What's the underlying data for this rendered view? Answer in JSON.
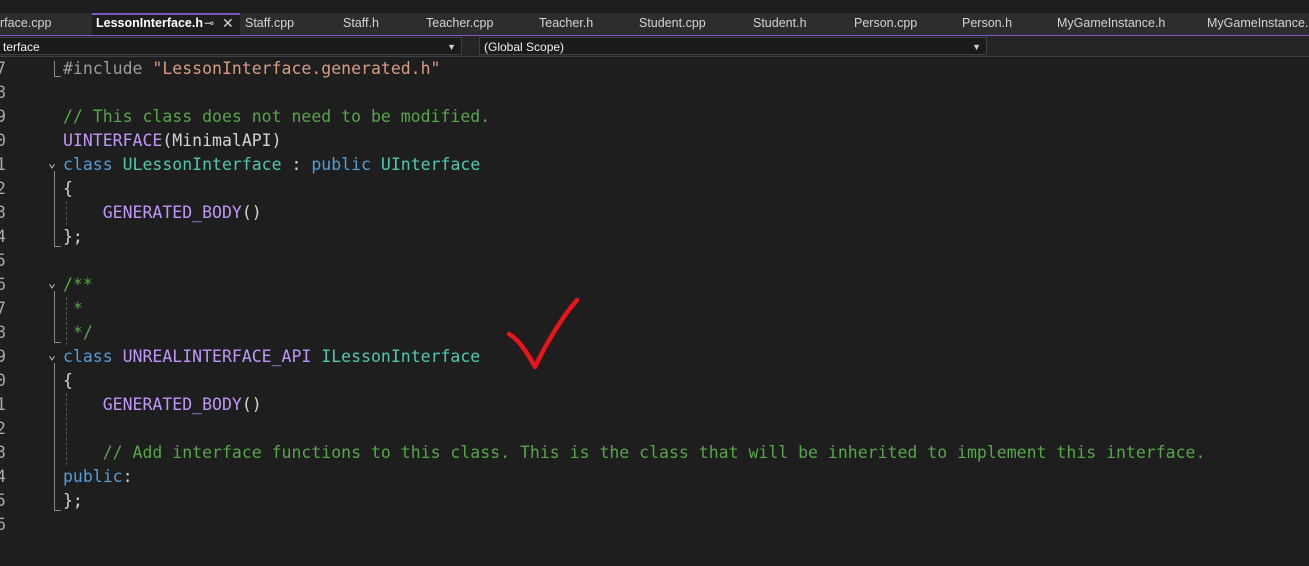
{
  "tabs": [
    {
      "label": "rface.cpp",
      "active": false
    },
    {
      "label": "LessonInterface.h",
      "active": true
    },
    {
      "label": "Staff.cpp",
      "active": false
    },
    {
      "label": "Staff.h",
      "active": false
    },
    {
      "label": "Teacher.cpp",
      "active": false
    },
    {
      "label": "Teacher.h",
      "active": false
    },
    {
      "label": "Student.cpp",
      "active": false
    },
    {
      "label": "Student.h",
      "active": false
    },
    {
      "label": "Person.cpp",
      "active": false
    },
    {
      "label": "Person.h",
      "active": false
    },
    {
      "label": "MyGameInstance.h",
      "active": false
    },
    {
      "label": "MyGameInstance.c",
      "active": false
    }
  ],
  "scope": {
    "left_value": "terface",
    "right_value": "(Global Scope)"
  },
  "icons": {
    "pin": "pin-icon",
    "close": "close-icon",
    "dropdown": "chevron-down-icon",
    "fold": "fold-chevron-icon",
    "annotation": "red-checkmark-annotation"
  },
  "colors": {
    "accent": "#7e57c2",
    "keyword": "#569cd6",
    "class_name": "#4ec9b0",
    "macro": "#bd98f8",
    "string": "#d69d85",
    "comment": "#57a64a",
    "checkmark": "#e8141c"
  },
  "editor": {
    "lines": [
      {
        "num": "7",
        "tokens": [
          [
            "pp",
            "#include "
          ],
          [
            "str",
            "\"LessonInterface.generated.h\""
          ]
        ]
      },
      {
        "num": "8",
        "tokens": []
      },
      {
        "num": "9",
        "tokens": [
          [
            "cmt",
            "// This class does not need to be modified."
          ]
        ]
      },
      {
        "num": "0",
        "tokens": [
          [
            "mac",
            "UINTERFACE"
          ],
          [
            "txt",
            "(MinimalAPI)"
          ]
        ]
      },
      {
        "num": "1",
        "fold": true,
        "tokens": [
          [
            "kw",
            "class "
          ],
          [
            "cls",
            "ULessonInterface"
          ],
          [
            "txt",
            " : "
          ],
          [
            "kw",
            "public "
          ],
          [
            "cls",
            "UInterface"
          ]
        ]
      },
      {
        "num": "2",
        "tokens": [
          [
            "txt",
            "{"
          ]
        ]
      },
      {
        "num": "3",
        "tokens": [
          [
            "txt",
            "    "
          ],
          [
            "mac",
            "GENERATED_BODY"
          ],
          [
            "txt",
            "()"
          ]
        ]
      },
      {
        "num": "4",
        "tokens": [
          [
            "txt",
            "};"
          ]
        ]
      },
      {
        "num": "5",
        "tokens": []
      },
      {
        "num": "6",
        "fold": true,
        "tokens": [
          [
            "cmt",
            "/**"
          ]
        ]
      },
      {
        "num": "7",
        "tokens": [
          [
            "cmt",
            " *"
          ]
        ]
      },
      {
        "num": "8",
        "tokens": [
          [
            "cmt",
            " */"
          ]
        ]
      },
      {
        "num": "9",
        "fold": true,
        "tokens": [
          [
            "kw",
            "class "
          ],
          [
            "mac",
            "UNREALINTERFACE_API "
          ],
          [
            "cls",
            "ILessonInterface"
          ]
        ]
      },
      {
        "num": "0",
        "tokens": [
          [
            "txt",
            "{"
          ]
        ]
      },
      {
        "num": "1",
        "tokens": [
          [
            "txt",
            "    "
          ],
          [
            "mac",
            "GENERATED_BODY"
          ],
          [
            "txt",
            "()"
          ]
        ]
      },
      {
        "num": "2",
        "tokens": []
      },
      {
        "num": "3",
        "tokens": [
          [
            "txt",
            "    "
          ],
          [
            "cmt",
            "// Add interface functions to this class. This is the class that will be inherited to implement this interface."
          ]
        ]
      },
      {
        "num": "4",
        "tokens": [
          [
            "kw",
            "public"
          ],
          [
            "txt",
            ":"
          ]
        ]
      },
      {
        "num": "5",
        "tokens": [
          [
            "txt",
            "};"
          ]
        ]
      },
      {
        "num": "6",
        "tokens": []
      }
    ]
  }
}
